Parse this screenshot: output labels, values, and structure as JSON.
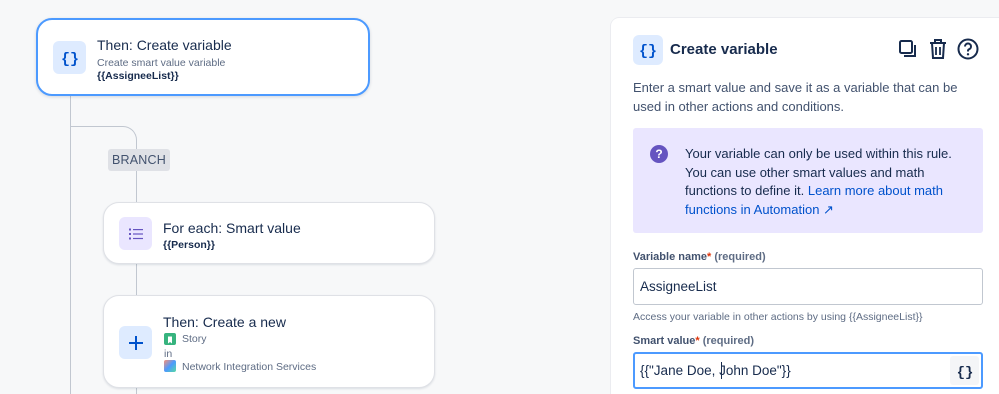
{
  "flow": {
    "create_variable": {
      "title": "Then: Create variable",
      "subtitle": "Create smart value variable",
      "value": "{{AssigneeList}}",
      "icon": "braces-icon"
    },
    "branch_label": "BRANCH",
    "for_each": {
      "title": "For each: Smart value",
      "value": "{{Person}}",
      "icon": "list-icon"
    },
    "create_new": {
      "title": "Then: Create a new",
      "issue_type": "Story",
      "in_label": "in",
      "project": "Network Integration Services",
      "icon": "plus-icon"
    }
  },
  "panel": {
    "title": "Create variable",
    "description": "Enter a smart value and save it as a variable that can be used in other actions and conditions.",
    "info": {
      "text": "Your variable can only be used within this rule. You can use other smart values and math functions to define it. ",
      "link": "Learn more about math functions in Automation",
      "link_arrow": "↗"
    },
    "variable_name": {
      "label": "Variable name",
      "required_mark": "*",
      "required_text": "(required)",
      "value": "AssigneeList",
      "help": "Access your variable in other actions by using {{AssigneeList}}"
    },
    "smart_value": {
      "label": "Smart value",
      "required_mark": "*",
      "required_text": "(required)",
      "value": "{{\"Jane Doe, John Doe\"}}"
    },
    "tools": [
      "copy-icon",
      "trash-icon",
      "help-icon"
    ]
  },
  "colors": {
    "accent_blue": "#0052cc",
    "selected_border": "#4c9aff",
    "info_bg": "#eae6ff",
    "info_icon": "#6554c0",
    "story_green": "#36b37e"
  }
}
